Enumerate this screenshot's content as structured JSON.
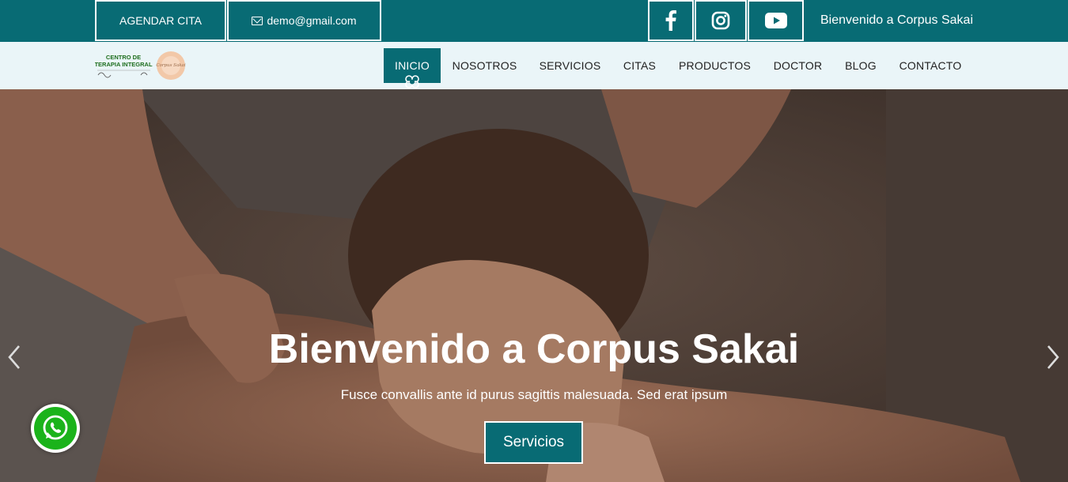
{
  "topbar": {
    "schedule_label": "AGENDAR CITA",
    "email": "demo@gmail.com",
    "welcome": "Bienvenido a Corpus Sakai",
    "socials": [
      "facebook-icon",
      "instagram-icon",
      "youtube-icon"
    ]
  },
  "logo": {
    "line1": "CENTRO DE",
    "line2": "TERAPIA INTEGRAL",
    "script": "Corpus Sakai"
  },
  "nav": {
    "items": [
      {
        "label": "INICIO",
        "active": true
      },
      {
        "label": "NOSOTROS"
      },
      {
        "label": "SERVICIOS"
      },
      {
        "label": "CITAS"
      },
      {
        "label": "PRODUCTOS"
      },
      {
        "label": "DOCTOR"
      },
      {
        "label": "BLOG"
      },
      {
        "label": "CONTACTO"
      }
    ]
  },
  "hero": {
    "title": "Bienvenido a Corpus Sakai",
    "subtitle": "Fusce convallis ante id purus sagittis malesuada. Sed erat ipsum",
    "button": "Servicios"
  },
  "colors": {
    "accent": "#086b74",
    "nav_bg": "#eaf5f8",
    "whatsapp": "#1bb31b"
  }
}
